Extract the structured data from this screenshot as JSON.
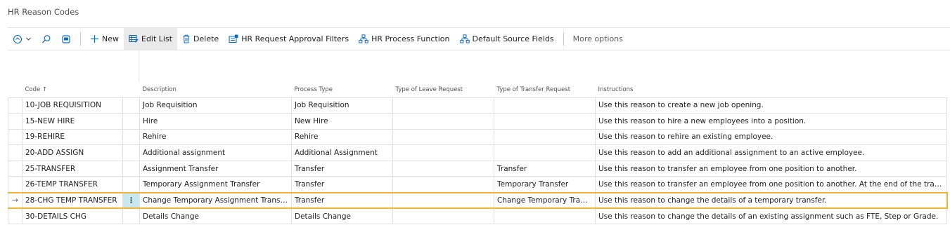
{
  "page": {
    "title": "HR Reason Codes"
  },
  "toolbar": {
    "new_label": "New",
    "edit_list_label": "Edit List",
    "delete_label": "Delete",
    "approval_filters_label": "HR Request Approval Filters",
    "process_function_label": "HR Process Function",
    "default_source_fields_label": "Default Source Fields",
    "more_options_label": "More options"
  },
  "table": {
    "headers": {
      "code": "Code",
      "code_sort": "↑",
      "description": "Description",
      "process_type": "Process Type",
      "leave_request": "Type of Leave Request",
      "transfer_request": "Type of Transfer Request",
      "instructions": "Instructions"
    },
    "current_row_marker": "→",
    "row_menu_glyph": "⋮",
    "rows": [
      {
        "code": "10-JOB REQUISITION",
        "description": "Job Requisition",
        "process_type": "Job Requisition",
        "leave_request": "",
        "transfer_request": "",
        "instructions": "Use this reason to create a new job opening."
      },
      {
        "code": "15-NEW HIRE",
        "description": "Hire",
        "process_type": "New Hire",
        "leave_request": "",
        "transfer_request": "",
        "instructions": "Use this reason to hire a new employees into a position."
      },
      {
        "code": "19-REHIRE",
        "description": "Rehire",
        "process_type": "Rehire",
        "leave_request": "",
        "transfer_request": "",
        "instructions": "Use this reason to rehire an existing employee."
      },
      {
        "code": "20-ADD ASSIGN",
        "description": "Additional assignment",
        "process_type": "Additional Assignment",
        "leave_request": "",
        "transfer_request": "",
        "instructions": "Use this reason to add an additional assignment to an active employee."
      },
      {
        "code": "25-TRANSFER",
        "description": "Assignment Transfer",
        "process_type": "Transfer",
        "leave_request": "",
        "transfer_request": "Transfer",
        "instructions": "Use this reason to transfer an employee from one position to another."
      },
      {
        "code": "26-TEMP TRANSFER",
        "description": "Temporary Assignment Transfer",
        "process_type": "Transfer",
        "leave_request": "",
        "transfer_request": "Temporary Transfer",
        "instructions": "Use this reason to transfer an employee from one position to another. At the end of the transfer period, the employee will be returned to the original position."
      },
      {
        "code": "28-CHG TEMP TRANSFER",
        "description": "Change Temporary Assignment Transfer",
        "process_type": "Transfer",
        "leave_request": "",
        "transfer_request": "Change Temporary Transfer",
        "instructions": "Use this reason to change the details of a temporary transfer."
      },
      {
        "code": "30-DETAILS CHG",
        "description": "Details Change",
        "process_type": "Details Change",
        "leave_request": "",
        "transfer_request": "",
        "instructions": "Use this reason to change the details of an existing assignment such as FTE, Step or Grade."
      }
    ]
  },
  "colors": {
    "accent": "#f2b233",
    "selected_cell": "#c7e8ee",
    "icon_blue": "#0f6cbd"
  },
  "icons": [
    "list-view-icon",
    "search-icon",
    "filter-pane-icon",
    "plus-icon",
    "edit-list-icon",
    "trash-icon",
    "approval-filter-icon",
    "process-function-icon",
    "default-source-fields-icon"
  ]
}
